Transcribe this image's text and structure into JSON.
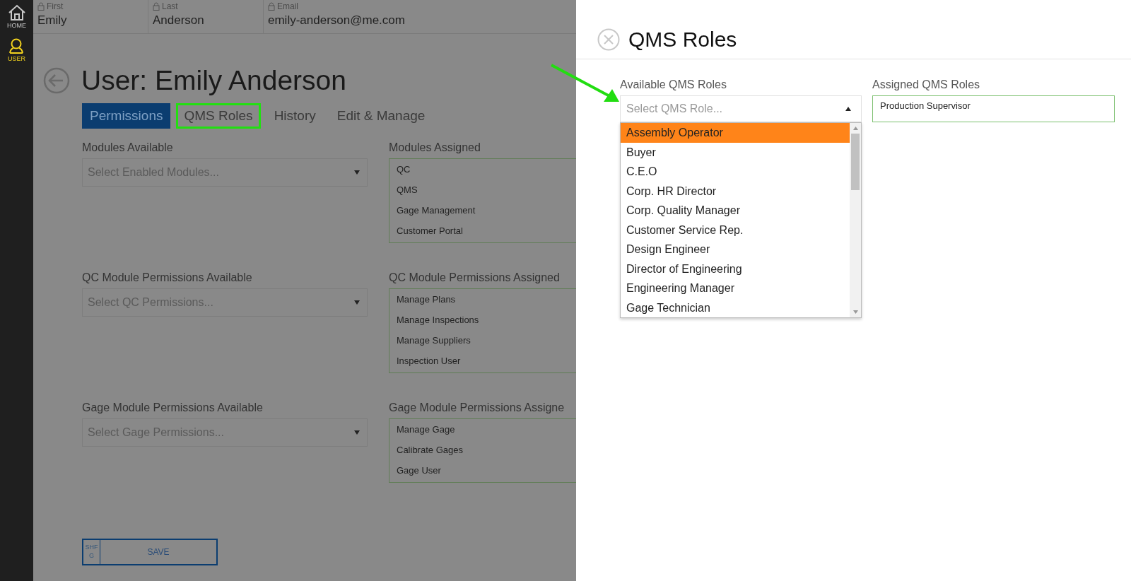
{
  "sidebar": {
    "items": [
      {
        "label": "HOME",
        "kind": "home",
        "selected": false
      },
      {
        "label": "USER",
        "kind": "user",
        "selected": true
      }
    ]
  },
  "header_fields": [
    {
      "label": "First",
      "value": "Emily"
    },
    {
      "label": "Last",
      "value": "Anderson"
    },
    {
      "label": "Email",
      "value": "emily-anderson@me.com"
    }
  ],
  "page_title": "User: Emily Anderson",
  "tabs": [
    {
      "label": "Permissions",
      "selected": true,
      "highlighted": false
    },
    {
      "label": "QMS Roles",
      "selected": false,
      "highlighted": true
    },
    {
      "label": "History",
      "selected": false,
      "highlighted": false
    },
    {
      "label": "Edit & Manage",
      "selected": false,
      "highlighted": false
    }
  ],
  "permission_groups": [
    {
      "available_label": "Modules Available",
      "placeholder": "Select Enabled Modules...",
      "assigned_label": "Modules Assigned",
      "assigned": [
        "QC",
        "QMS",
        "Gage Management",
        "Customer Portal"
      ]
    },
    {
      "available_label": "QC Module Permissions Available",
      "placeholder": "Select QC Permissions...",
      "assigned_label": "QC Module Permissions Assigned",
      "assigned": [
        "Manage Plans",
        "Manage Inspections",
        "Manage Suppliers",
        "Inspection User"
      ]
    },
    {
      "available_label": "Gage Module Permissions Available",
      "placeholder": "Select Gage Permissions...",
      "assigned_label": "Gage Module Permissions Assigne",
      "assigned": [
        "Manage Gage",
        "Calibrate Gages",
        "Gage User"
      ]
    }
  ],
  "save_button": {
    "shortcut": "SHFG",
    "label": "SAVE"
  },
  "panel": {
    "title": "QMS Roles",
    "available_label": "Available QMS Roles",
    "placeholder": "Select QMS Role...",
    "expanded": true,
    "options": [
      {
        "label": "Assembly Operator",
        "selected": true
      },
      {
        "label": "Buyer",
        "selected": false
      },
      {
        "label": "C.E.O",
        "selected": false
      },
      {
        "label": "Corp. HR Director",
        "selected": false
      },
      {
        "label": "Corp. Quality Manager",
        "selected": false
      },
      {
        "label": "Customer Service Rep.",
        "selected": false
      },
      {
        "label": "Design Engineer",
        "selected": false
      },
      {
        "label": "Director of Engineering",
        "selected": false
      },
      {
        "label": "Engineering Manager",
        "selected": false
      },
      {
        "label": "Gage Technician",
        "selected": false
      }
    ],
    "assigned_label": "Assigned QMS Roles",
    "assigned": [
      "Production Supervisor"
    ]
  }
}
